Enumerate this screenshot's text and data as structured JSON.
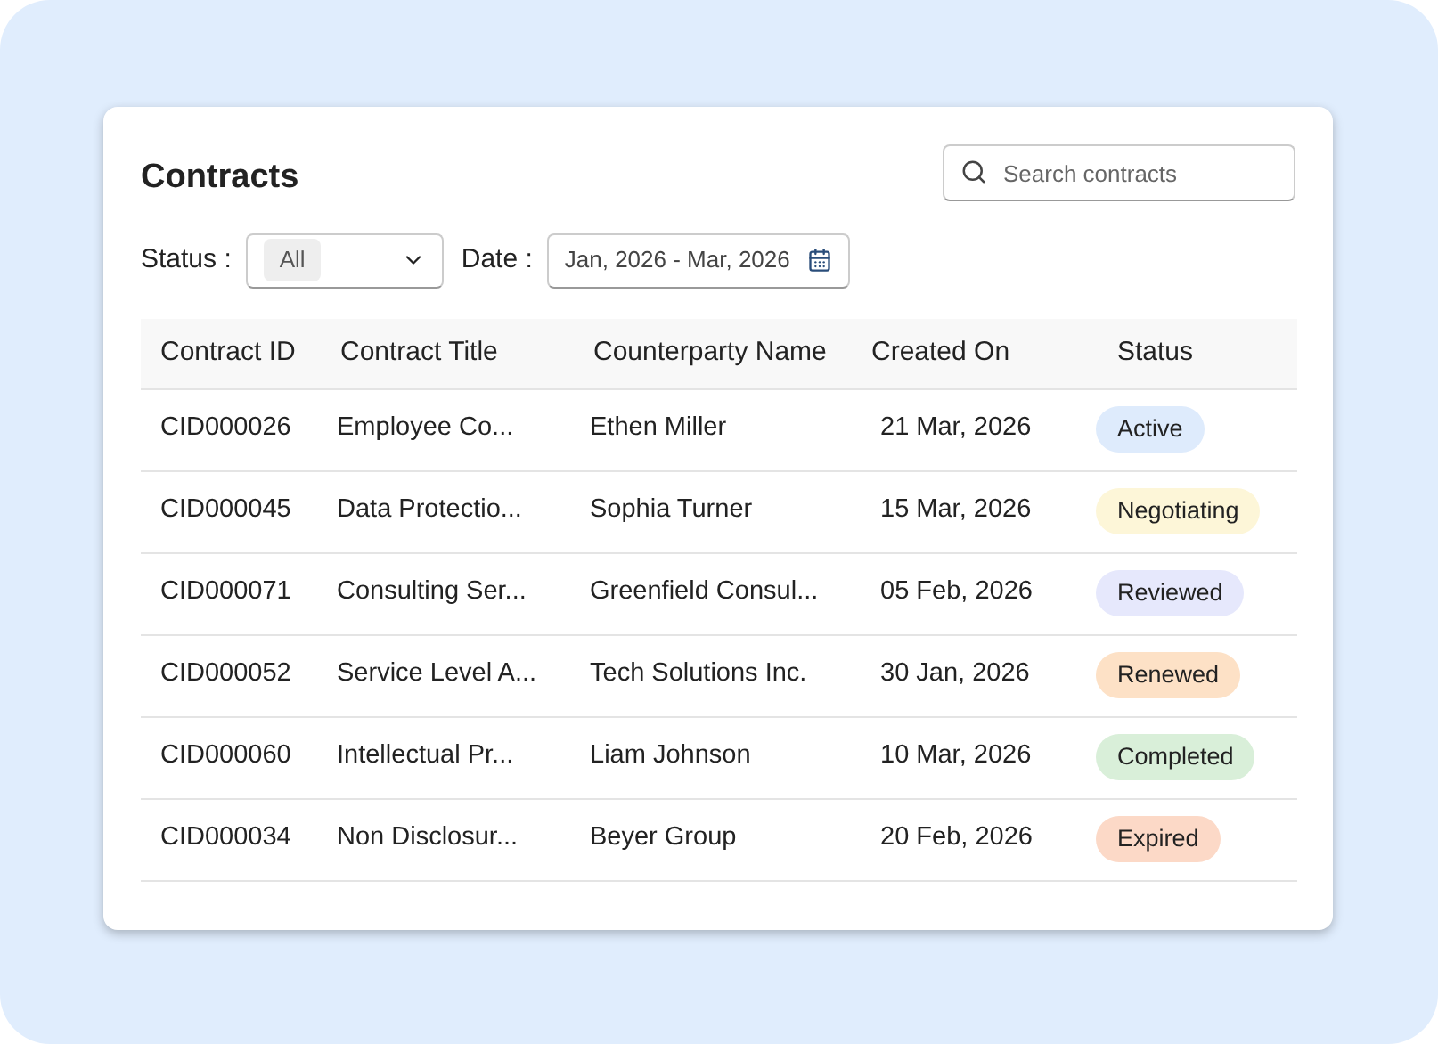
{
  "title": "Contracts",
  "search": {
    "placeholder": "Search contracts"
  },
  "filters": {
    "status_label": "Status :",
    "status_value": "All",
    "date_label": "Date :",
    "date_value": "Jan, 2026 - Mar, 2026"
  },
  "table": {
    "columns": [
      "Contract ID",
      "Contract Title",
      "Counterparty Name",
      "Created On",
      "Status"
    ],
    "rows": [
      {
        "id": "CID000026",
        "title": "Employee Co...",
        "counterparty": "Ethen Miller",
        "created": "21 Mar, 2026",
        "status": "Active",
        "color": "#deebfc"
      },
      {
        "id": "CID000045",
        "title": "Data Protectio...",
        "counterparty": "Sophia Turner",
        "created": "15 Mar, 2026",
        "status": "Negotiating",
        "color": "#fdf6d8"
      },
      {
        "id": "CID000071",
        "title": "Consulting Ser...",
        "counterparty": "Greenfield Consul...",
        "created": "05 Feb, 2026",
        "status": "Reviewed",
        "color": "#e6e8fc"
      },
      {
        "id": "CID000052",
        "title": "Service Level A...",
        "counterparty": "Tech Solutions Inc.",
        "created": "30 Jan, 2026",
        "status": "Renewed",
        "color": "#fde1c6"
      },
      {
        "id": "CID000060",
        "title": "Intellectual Pr...",
        "counterparty": "Liam Johnson",
        "created": "10 Mar, 2026",
        "status": "Completed",
        "color": "#d9efd9"
      },
      {
        "id": "CID000034",
        "title": "Non Disclosur...",
        "counterparty": "Beyer Group",
        "created": "20 Feb, 2026",
        "status": "Expired",
        "color": "#fcd9c7"
      }
    ]
  }
}
